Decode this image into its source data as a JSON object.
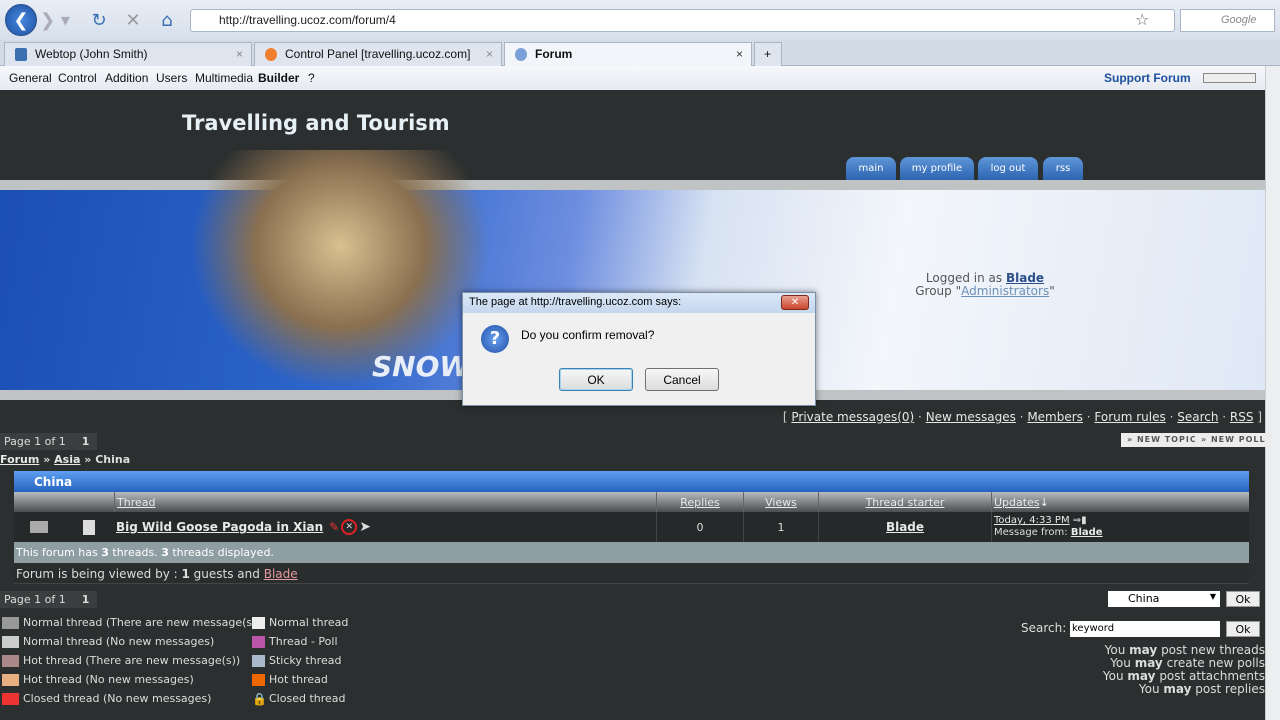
{
  "browser": {
    "url": "http://travelling.ucoz.com/forum/4",
    "search_placeholder": "Google",
    "tabs": [
      {
        "label": "Webtop (John Smith)"
      },
      {
        "label": "Control Panel [travelling.ucoz.com]"
      },
      {
        "label": "Forum"
      }
    ],
    "new_tab": "+"
  },
  "ucoz_bar": {
    "items": [
      "General",
      "Control",
      "Addition",
      "Users",
      "Multimedia",
      "Builder",
      "?"
    ],
    "support": "Support Forum"
  },
  "site": {
    "title": "Travelling and Tourism",
    "tabs": [
      "main",
      "my profile",
      "log out",
      "rss"
    ],
    "banner_text": "SNOW",
    "logged_in_prefix": "Logged in as",
    "user": "Blade",
    "group_prefix": "Group",
    "group": "Administrators"
  },
  "links": {
    "open": "[",
    "items": [
      "Private messages(0)",
      "New messages",
      "Members",
      "Forum rules",
      "Search",
      "RSS"
    ],
    "close": "]"
  },
  "pager": {
    "label": "Page 1 of 1",
    "page": "1"
  },
  "buttons": {
    "new_topic": "NEW TOPIC",
    "new_poll": "NEW POLL"
  },
  "breadcrumb": {
    "forum": "Forum",
    "sep": "»",
    "asia": "Asia",
    "current": "China"
  },
  "forum": {
    "name": "China",
    "columns": {
      "thread": "Thread",
      "replies": "Replies",
      "views": "Views",
      "starter": "Thread starter",
      "updates": "Updates"
    },
    "rows": [
      {
        "title": "Big Wild Goose Pagoda in Xian",
        "replies": "0",
        "views": "1",
        "starter": "Blade",
        "updated": "Today, 4:33 PM",
        "message_from_label": "Message from:",
        "message_from": "Blade"
      }
    ],
    "summary": {
      "p1": "This forum has",
      "threads": "3",
      "p2": "threads.",
      "displayed": "3",
      "p3": "threads displayed."
    },
    "viewers": {
      "p1": "Forum is being viewed by :",
      "guests": "1",
      "p2": "guests and",
      "user": "Blade"
    }
  },
  "legend": {
    "left": [
      "Normal thread (There are new message(s))",
      "Normal thread (No new messages)",
      "Hot thread (There are new message(s))",
      "Hot thread (No new messages)",
      "Closed thread (No new messages)"
    ],
    "right": [
      "Normal thread",
      "Thread - Poll",
      "Sticky thread",
      "Hot thread",
      "Closed thread"
    ]
  },
  "jump": {
    "selected": "China",
    "ok": "Ok"
  },
  "search": {
    "label": "Search:",
    "value": "keyword",
    "ok": "Ok"
  },
  "permissions": [
    {
      "a": "You",
      "b": "may",
      "c": "post new threads"
    },
    {
      "a": "You",
      "b": "may",
      "c": "create new polls"
    },
    {
      "a": "You",
      "b": "may",
      "c": "post attachments"
    },
    {
      "a": "You",
      "b": "may",
      "c": "post replies"
    }
  ],
  "dialog": {
    "title": "The page at http://travelling.ucoz.com says:",
    "message": "Do you confirm removal?",
    "ok": "OK",
    "cancel": "Cancel"
  }
}
